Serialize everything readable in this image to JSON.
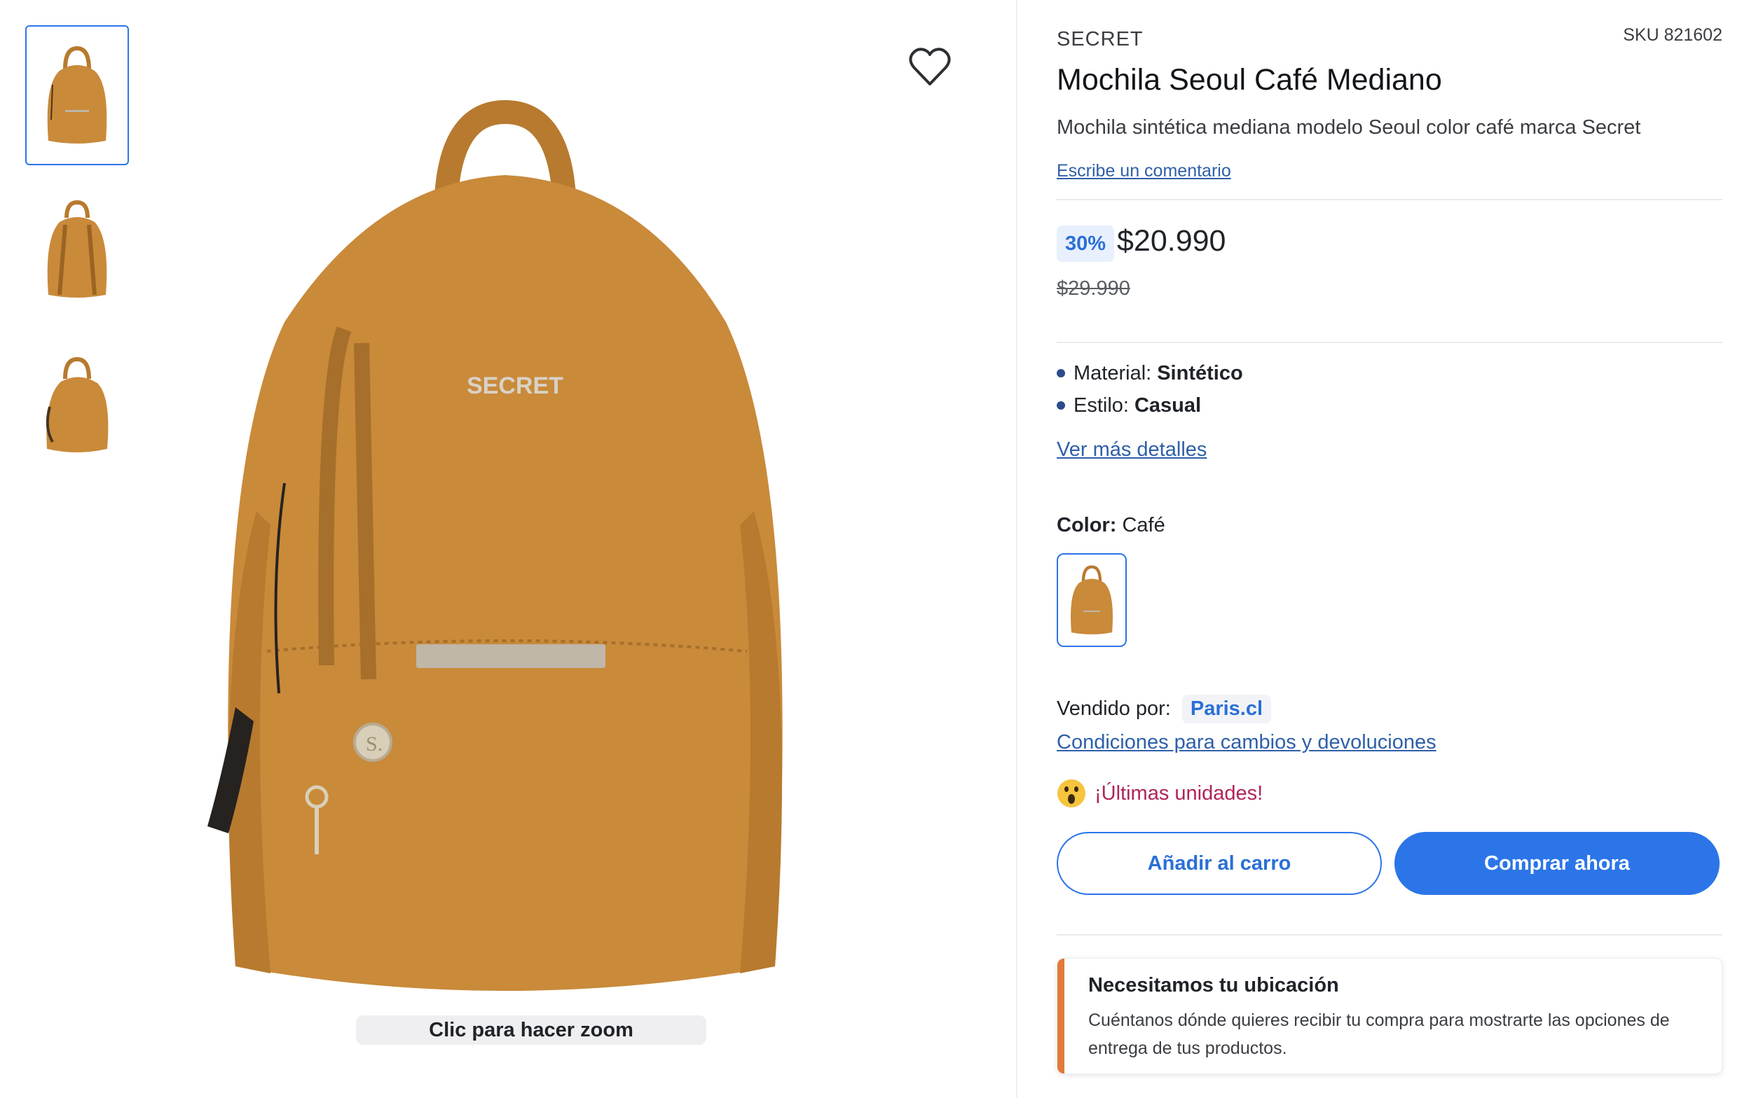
{
  "gallery": {
    "thumbnails": [
      "front-view",
      "back-view",
      "side-view"
    ],
    "active_index": 0,
    "zoom_hint": "Clic para hacer zoom",
    "main_logo_text": "SECRET"
  },
  "product": {
    "brand": "SECRET",
    "sku": "SKU 821602",
    "title": "Mochila Seoul Café Mediano",
    "description": "Mochila sintética mediana modelo Seoul color café marca Secret",
    "comment_link": "Escribe un comentario",
    "discount": "30%",
    "price": "$20.990",
    "old_price": "$29.990",
    "attributes": [
      {
        "label": "Material:",
        "value": "Sintético"
      },
      {
        "label": "Estilo:",
        "value": "Casual"
      }
    ],
    "details_link": "Ver más detalles",
    "color_label": "Color:",
    "color_value": "Café",
    "seller_label": "Vendido por:",
    "seller_name": "Paris.cl",
    "policy_link": "Condiciones para cambios y devoluciones",
    "stock_message": "¡Últimas unidades!",
    "add_to_cart": "Añadir al carro",
    "buy_now": "Comprar ahora"
  },
  "location_notice": {
    "title": "Necesitamos tu ubicación",
    "text": "Cuéntanos dónde quieres recibir tu compra para mostrarte las opciones de entrega de tus productos."
  },
  "colors": {
    "accent": "#2b75e8",
    "bag": "#c98a3a",
    "stock_warning": "#b0245a",
    "notice_bar": "#e27a3a"
  }
}
